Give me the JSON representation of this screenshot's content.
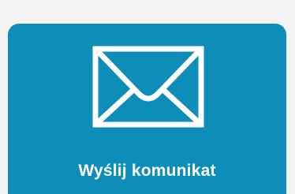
{
  "tile": {
    "label": "Wyślij komunikat",
    "icon": "envelope-icon",
    "background_color": "#0e8db8",
    "text_color": "#ffffff"
  },
  "page": {
    "background_color": "#f3f3f3"
  }
}
